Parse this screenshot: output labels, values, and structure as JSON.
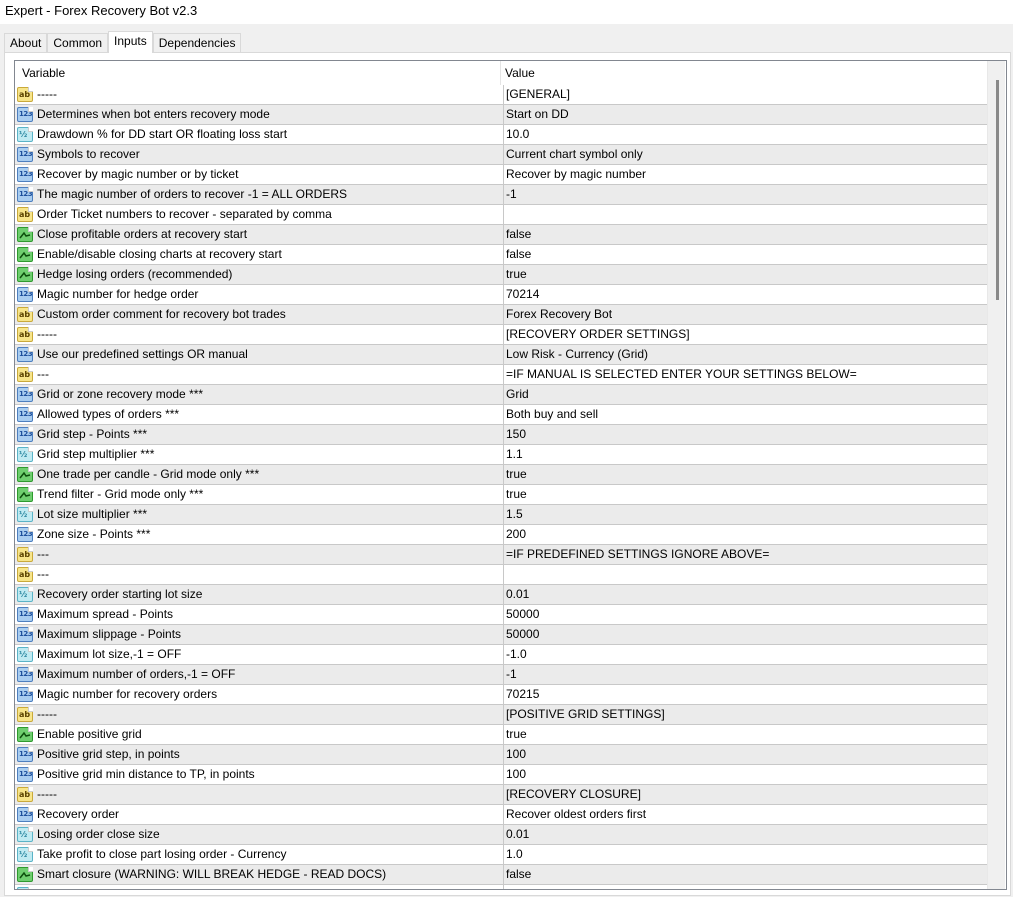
{
  "window": {
    "title": "Expert - Forex Recovery Bot v2.3"
  },
  "tabs": [
    {
      "label": "About",
      "active": false
    },
    {
      "label": "Common",
      "active": false
    },
    {
      "label": "Inputs",
      "active": true
    },
    {
      "label": "Dependencies",
      "active": false
    }
  ],
  "table": {
    "columns": {
      "variable": "Variable",
      "value": "Value"
    },
    "icon_types": {
      "string": {
        "icon": "string-ab-icon",
        "glyph": "ab"
      },
      "int": {
        "icon": "integer-123-icon",
        "glyph": "123"
      },
      "double": {
        "icon": "double-half-icon",
        "glyph": "½"
      },
      "bool": {
        "icon": "boolean-toggle-icon",
        "glyph": "⁄"
      }
    },
    "rows": [
      {
        "type": "string",
        "name": "-----",
        "value": "[GENERAL]"
      },
      {
        "type": "int",
        "name": "Determines when bot enters recovery mode",
        "value": "Start on DD"
      },
      {
        "type": "double",
        "name": "Drawdown % for DD start OR floating loss start",
        "value": "10.0"
      },
      {
        "type": "int",
        "name": "Symbols to recover",
        "value": "Current chart symbol only"
      },
      {
        "type": "int",
        "name": "Recover by magic number or by ticket",
        "value": "Recover by magic number"
      },
      {
        "type": "int",
        "name": "The magic number of orders to recover -1 = ALL ORDERS",
        "value": "-1"
      },
      {
        "type": "string",
        "name": "Order Ticket numbers to recover - separated by comma",
        "value": ""
      },
      {
        "type": "bool",
        "name": "Close profitable orders at recovery start",
        "value": "false"
      },
      {
        "type": "bool",
        "name": "Enable/disable closing charts at recovery start",
        "value": "false"
      },
      {
        "type": "bool",
        "name": "Hedge losing orders (recommended)",
        "value": "true"
      },
      {
        "type": "int",
        "name": "Magic number for hedge order",
        "value": "70214"
      },
      {
        "type": "string",
        "name": "Custom order comment for recovery bot trades",
        "value": "Forex Recovery Bot"
      },
      {
        "type": "string",
        "name": "-----",
        "value": "[RECOVERY ORDER SETTINGS]"
      },
      {
        "type": "int",
        "name": "Use our predefined settings OR manual",
        "value": "Low Risk - Currency (Grid)"
      },
      {
        "type": "string",
        "name": "---",
        "value": "=IF MANUAL IS SELECTED ENTER YOUR SETTINGS BELOW="
      },
      {
        "type": "int",
        "name": "Grid or zone recovery mode ***",
        "value": "Grid"
      },
      {
        "type": "int",
        "name": "Allowed types of orders ***",
        "value": "Both buy and sell"
      },
      {
        "type": "int",
        "name": "Grid step - Points ***",
        "value": "150"
      },
      {
        "type": "double",
        "name": "Grid step multiplier ***",
        "value": "1.1"
      },
      {
        "type": "bool",
        "name": "One trade per candle - Grid mode only ***",
        "value": "true"
      },
      {
        "type": "bool",
        "name": "Trend filter - Grid mode only ***",
        "value": "true"
      },
      {
        "type": "double",
        "name": "Lot size multiplier ***",
        "value": "1.5"
      },
      {
        "type": "int",
        "name": "Zone size - Points ***",
        "value": "200"
      },
      {
        "type": "string",
        "name": "---",
        "value": "=IF PREDEFINED SETTINGS IGNORE ABOVE="
      },
      {
        "type": "string",
        "name": "---",
        "value": ""
      },
      {
        "type": "double",
        "name": "Recovery order starting lot size",
        "value": "0.01"
      },
      {
        "type": "int",
        "name": "Maximum spread - Points",
        "value": "50000"
      },
      {
        "type": "int",
        "name": "Maximum slippage - Points",
        "value": "50000"
      },
      {
        "type": "double",
        "name": "Maximum lot size,-1 = OFF",
        "value": "-1.0"
      },
      {
        "type": "int",
        "name": "Maximum number of orders,-1 = OFF",
        "value": "-1"
      },
      {
        "type": "int",
        "name": "Magic number for recovery orders",
        "value": "70215"
      },
      {
        "type": "string",
        "name": "-----",
        "value": "[POSITIVE GRID SETTINGS]"
      },
      {
        "type": "bool",
        "name": "Enable positive grid",
        "value": "true"
      },
      {
        "type": "int",
        "name": "Positive grid step, in points",
        "value": "100"
      },
      {
        "type": "int",
        "name": "Positive grid min distance to TP, in points",
        "value": "100"
      },
      {
        "type": "string",
        "name": "-----",
        "value": "[RECOVERY CLOSURE]"
      },
      {
        "type": "int",
        "name": "Recovery order",
        "value": "Recover oldest orders first"
      },
      {
        "type": "double",
        "name": "Losing order close size",
        "value": "0.01"
      },
      {
        "type": "double",
        "name": "Take profit to close part losing order - Currency",
        "value": "1.0"
      },
      {
        "type": "bool",
        "name": "Smart closure (WARNING: WILL BREAK HEDGE - READ DOCS)",
        "value": "false"
      },
      {
        "type": "double",
        "name": "",
        "value": ""
      }
    ]
  },
  "scrollbar": {
    "visible_fraction": 0.27,
    "position_fraction": 0.0
  }
}
